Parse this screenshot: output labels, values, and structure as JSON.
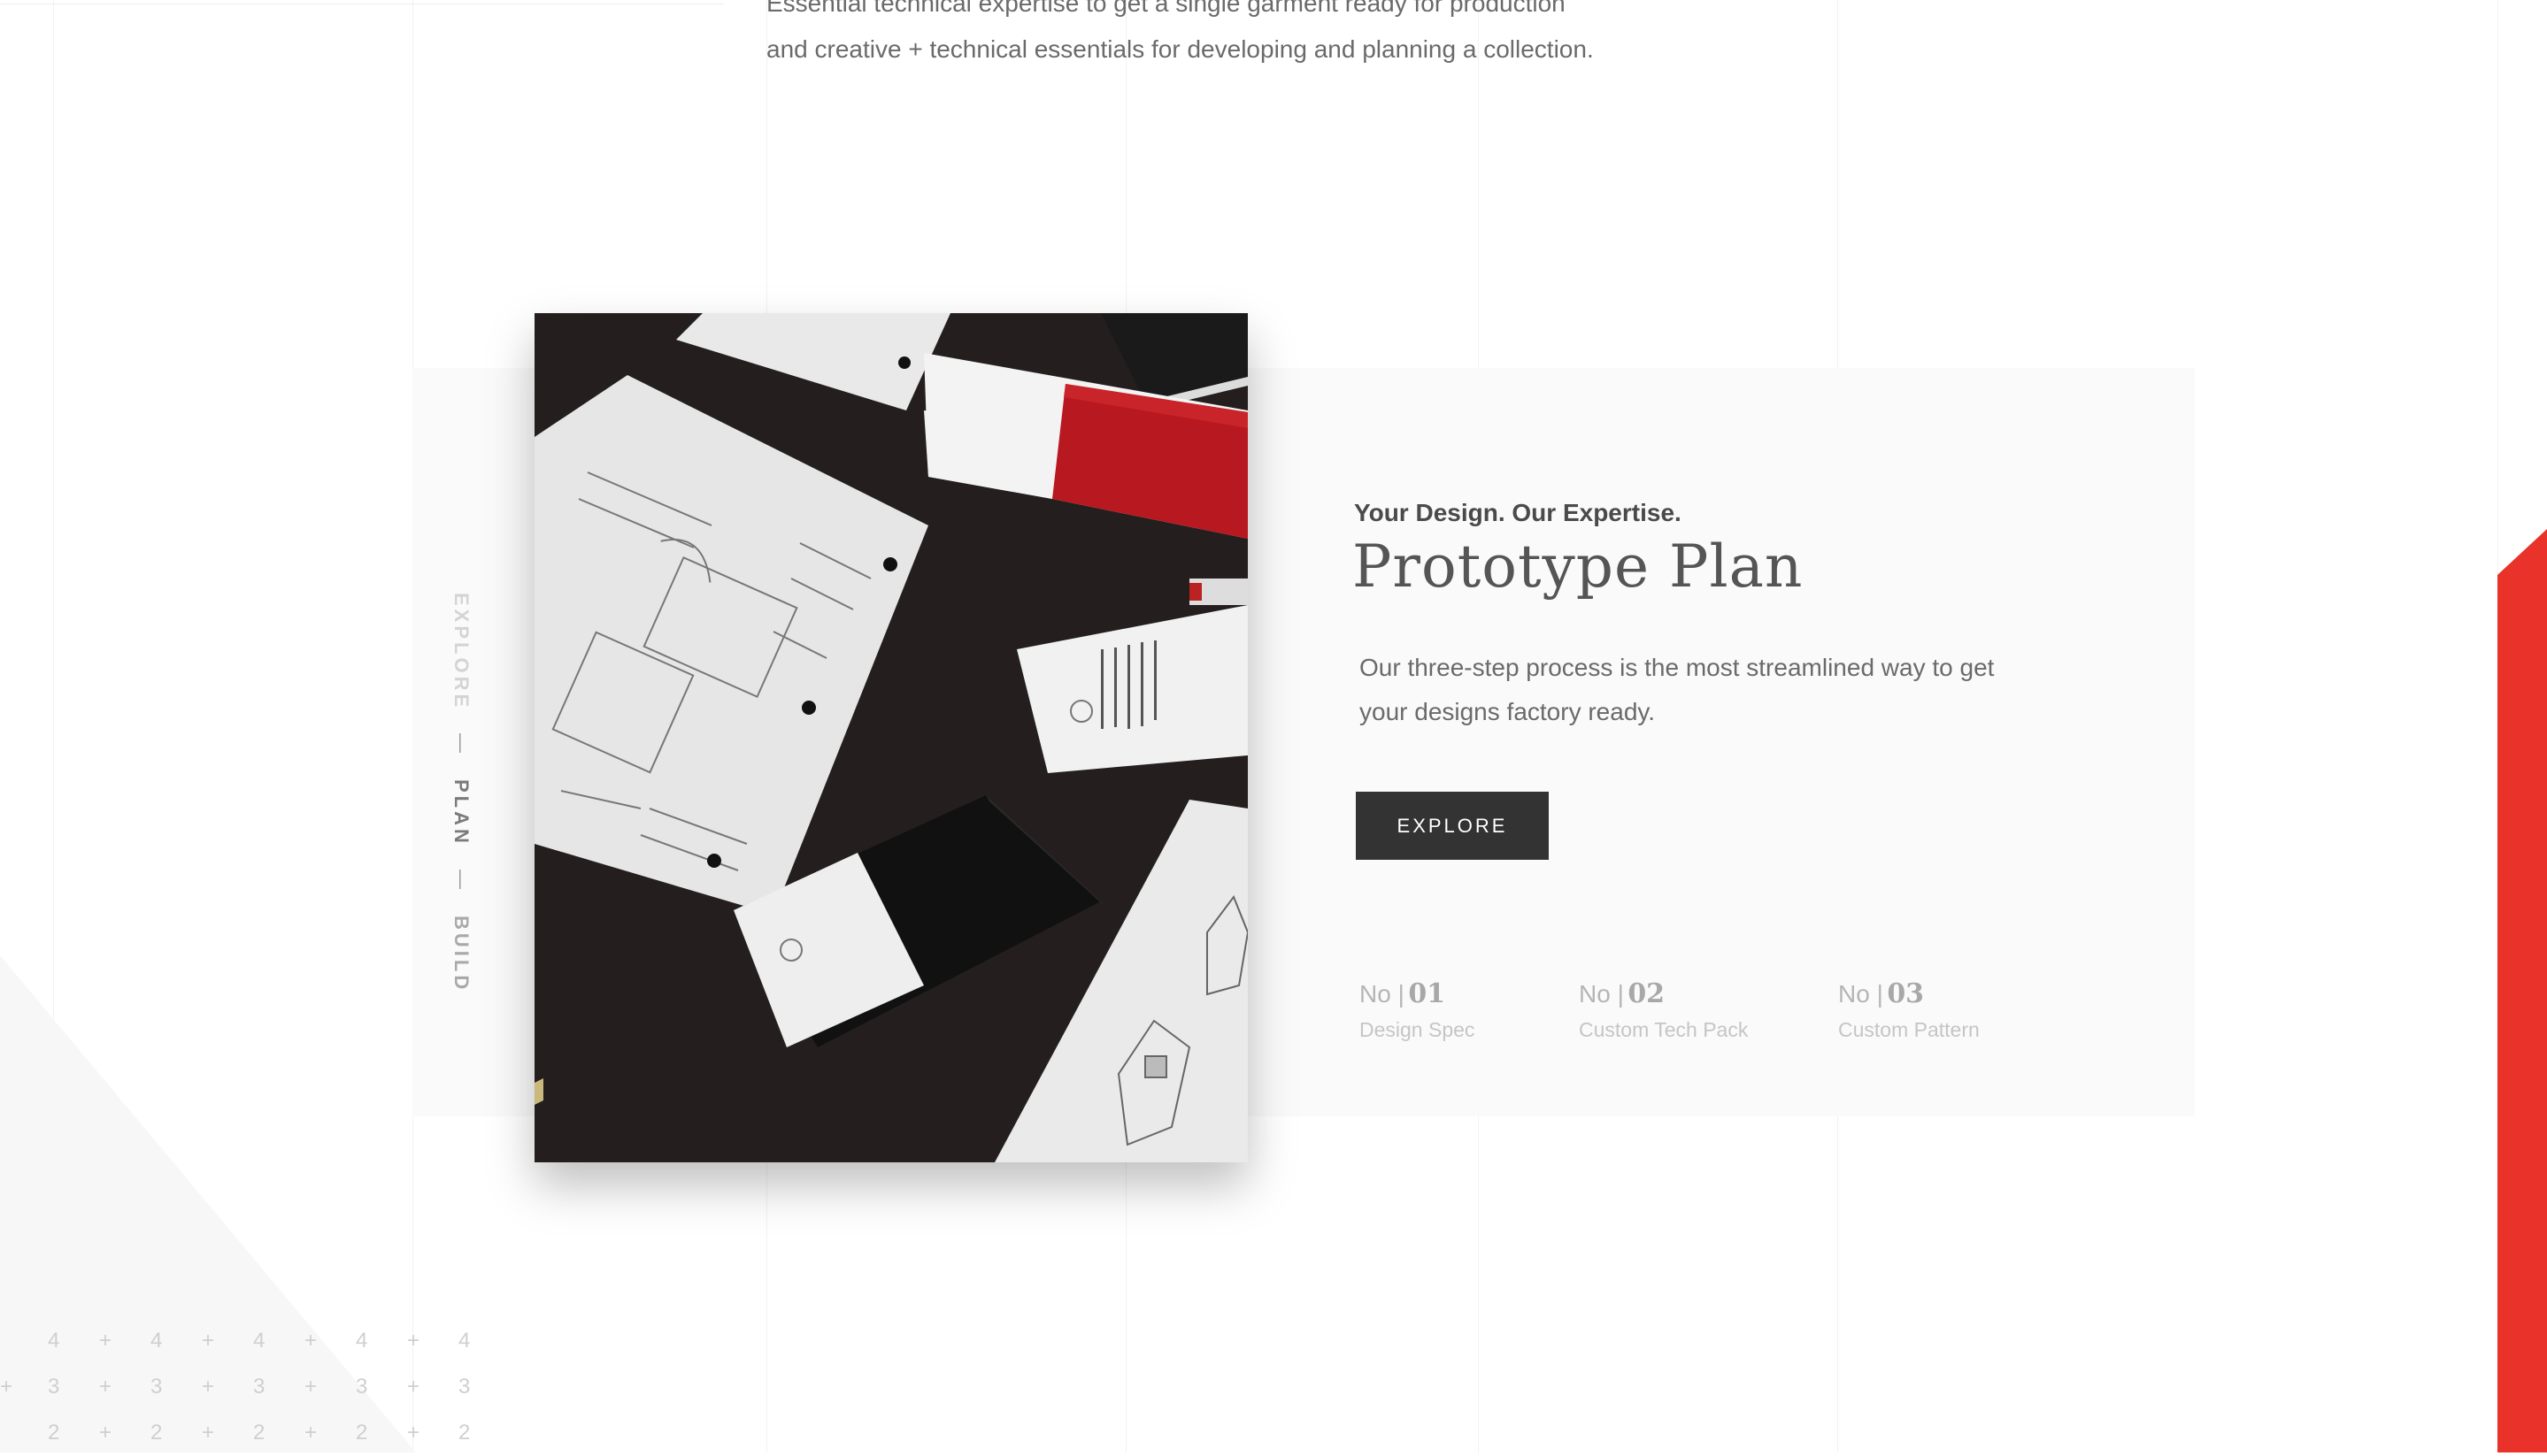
{
  "intro": {
    "line1": "Essential technical expertise to get a single garment ready for production",
    "line2": "and creative + technical essentials for developing and planning a collection."
  },
  "side_nav": {
    "items": [
      "EXPLORE",
      "PLAN",
      "BUILD"
    ],
    "separator": "—",
    "active": "PLAN"
  },
  "section": {
    "eyebrow": "Your Design. Our Expertise.",
    "title": "Prototype Plan",
    "description": "Our three-step process is the most streamlined way to get your designs factory ready.",
    "button_label": "EXPLORE"
  },
  "steps": [
    {
      "prefix": "No |",
      "number": "01",
      "label": "Design Spec"
    },
    {
      "prefix": "No |",
      "number": "02",
      "label": "Custom Tech Pack"
    },
    {
      "prefix": "No |",
      "number": "03",
      "label": "Custom Pattern"
    }
  ],
  "grid_numbers": {
    "row1": "4",
    "row2": "3",
    "row3": "2",
    "marker": "+"
  },
  "colors": {
    "accent_red": "#e8322a",
    "button_dark": "#333333",
    "panel_bg": "#fafafa"
  }
}
